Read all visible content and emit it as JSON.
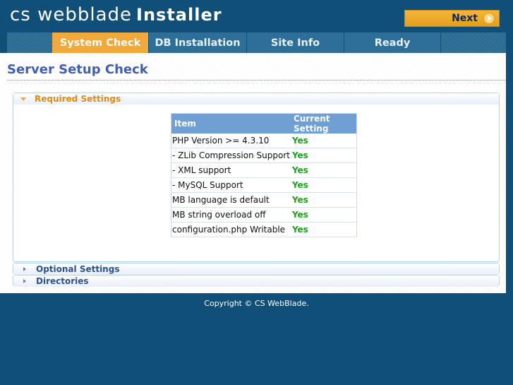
{
  "header": {
    "logo_brand": "cs webblade",
    "logo_installer": "Installer",
    "next_label": "Next"
  },
  "tabs": [
    {
      "label": "System Check",
      "active": true
    },
    {
      "label": "DB Installation",
      "active": false
    },
    {
      "label": "Site Info",
      "active": false
    },
    {
      "label": "Ready",
      "active": false
    }
  ],
  "page_title": "Server Setup Check",
  "panels": {
    "required": "Required Settings",
    "optional": "Optional Settings",
    "directories": "Directories"
  },
  "table": {
    "headers": [
      "Item",
      "Current Setting"
    ],
    "rows": [
      {
        "item": "PHP Version >= 4.3.10",
        "value": "Yes"
      },
      {
        "item": "- ZLib Compression Support",
        "value": "Yes"
      },
      {
        "item": "- XML support",
        "value": "Yes"
      },
      {
        "item": "- MySQL Support",
        "value": "Yes"
      },
      {
        "item": "MB language is default",
        "value": "Yes"
      },
      {
        "item": "MB string overload off",
        "value": "Yes"
      },
      {
        "item": "configuration.php Writable",
        "value": "Yes"
      }
    ]
  },
  "footer": "Copyright © CS WebBlade.",
  "colors": {
    "background": "#0f4f78",
    "active_tab": "#f0a93a",
    "title": "#3f5fb0",
    "yes": "#1aa31a"
  }
}
